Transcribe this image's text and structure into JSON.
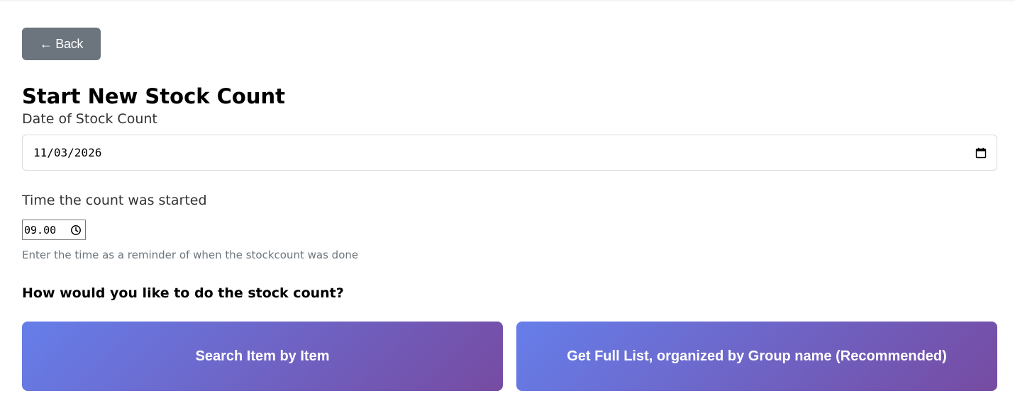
{
  "back_button": {
    "label": "← Back"
  },
  "page_title": "Start New Stock Count",
  "date_field": {
    "label": "Date of Stock Count",
    "value": "11/03/2026",
    "icon": "calendar-icon"
  },
  "time_field": {
    "label": "Time the count was started",
    "value": "09.00",
    "icon": "clock-icon",
    "help_text": "Enter the time as a reminder of when the stockcount was done"
  },
  "method": {
    "question": "How would you like to do the stock count?",
    "options": [
      {
        "label": "Search Item by Item"
      },
      {
        "label": "Get Full List, organized by Group name (Recommended)"
      }
    ]
  },
  "colors": {
    "back_button_bg": "#6c757d",
    "gradient_start": "#667eea",
    "gradient_end": "#764ba2"
  }
}
